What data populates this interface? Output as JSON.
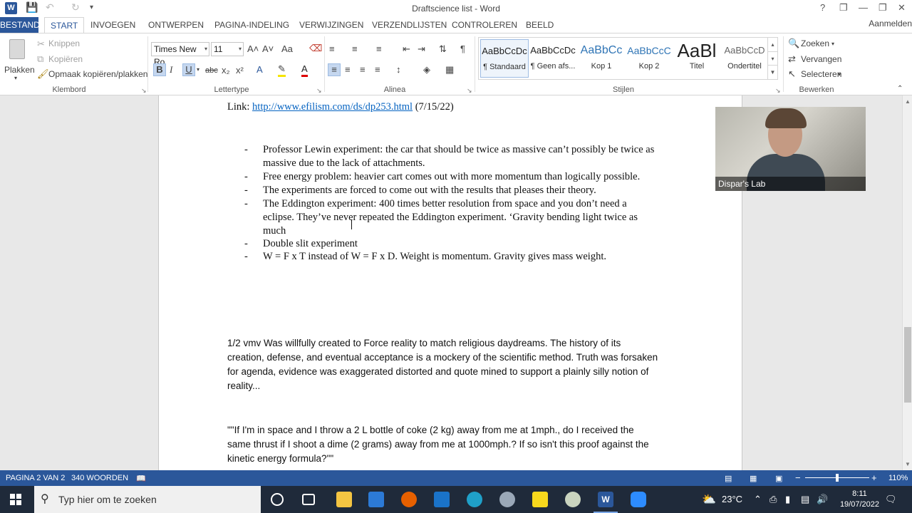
{
  "window": {
    "title": "Draftscience list - Word",
    "signin": "Aanmelden",
    "help": "?",
    "restore_ribbon": "❐",
    "minimize": "—",
    "maximize": "❐",
    "close": "✕"
  },
  "tabs": [
    "BESTAND",
    "START",
    "INVOEGEN",
    "ONTWERPEN",
    "PAGINA-INDELING",
    "VERWIJZINGEN",
    "VERZENDLIJSTEN",
    "CONTROLEREN",
    "BEELD"
  ],
  "ribbon": {
    "clipboard": {
      "paste": "Plakken",
      "cut": "Knippen",
      "copy": "Kopiëren",
      "format_painter": "Opmaak kopiëren/plakken",
      "label": "Klembord"
    },
    "font": {
      "name": "Times New Ro",
      "size": "11",
      "label": "Lettertype",
      "bold": "B",
      "italic": "I",
      "underline": "U",
      "strike": "abc",
      "sub": "x₂",
      "sup": "x²",
      "grow": "A˄",
      "shrink": "A˅",
      "case": "Aa",
      "clear": "A"
    },
    "paragraph": {
      "label": "Alinea",
      "pilcrow": "¶"
    },
    "styles": {
      "label": "Stijlen",
      "items": [
        {
          "preview": "AaBbCcDc",
          "name": "¶ Standaard"
        },
        {
          "preview": "AaBbCcDc",
          "name": "¶ Geen afs..."
        },
        {
          "preview": "AaBbCc",
          "name": "Kop 1"
        },
        {
          "preview": "AaBbCcC",
          "name": "Kop 2"
        },
        {
          "preview": "AaBl",
          "name": "Titel"
        },
        {
          "preview": "AaBbCcD",
          "name": "Ondertitel"
        }
      ]
    },
    "editing": {
      "label": "Bewerken",
      "find": "Zoeken",
      "replace": "Vervangen",
      "select": "Selecteren"
    }
  },
  "document": {
    "link_prefix": "Link: ",
    "link_url": "http://www.efilism.com/ds/dp253.html",
    "link_suffix": " (7/15/22)",
    "bullets": [
      {
        "lines": [
          "Professor Lewin experiment: the car that should be twice as massive can’t possibly be twice as",
          "massive due to the lack of attachments."
        ]
      },
      {
        "lines": [
          "Free energy problem: heavier cart comes out with more momentum than logically possible."
        ]
      },
      {
        "lines": [
          "The experiments are forced to come out with the results that pleases their theory."
        ]
      },
      {
        "lines": [
          "The Eddington experiment: 400 times better resolution from space and you don’t need a",
          "eclipse. They’ve never repeated the Eddington experiment. ‘Gravity bending light twice as",
          "much"
        ]
      },
      {
        "lines": [
          "Double slit experiment"
        ]
      },
      {
        "lines": [
          "W = F x T  instead of  W = F x D. Weight is momentum.  Gravity gives mass weight."
        ]
      }
    ],
    "bullet_mark": "-",
    "para1": [
      "1/2 vmv Was willfully created to Force reality to match religious daydreams. The history of its",
      "creation, defense, and eventual acceptance is a mockery of the scientific method. Truth was forsaken",
      "for agenda, evidence was exaggerated distorted and quote mined to support a plainly silly notion of",
      "reality..."
    ],
    "para2": [
      " \"\"If I'm in space and I throw a 2 L bottle of coke (2 kg) away from me at 1mph., do I received the",
      "same thrust if I shoot a dime (2 grams) away from me at 1000mph.? If so isn't this proof against the",
      "kinetic energy formula?\"\""
    ]
  },
  "webcam": {
    "label": "Dispar's Lab"
  },
  "statusbar": {
    "page": "PAGINA 2 VAN 2",
    "words": "340 WOORDEN",
    "zoom": "110%",
    "minus": "−",
    "plus": "+"
  },
  "taskbar": {
    "search_placeholder": "Typ hier om te zoeken",
    "temperature": "23°C",
    "time": "8:11",
    "date": "19/07/2022"
  },
  "colors": {
    "word_blue": "#2b579a",
    "link": "#0563c1",
    "taskbar": "#1f2a3a"
  }
}
